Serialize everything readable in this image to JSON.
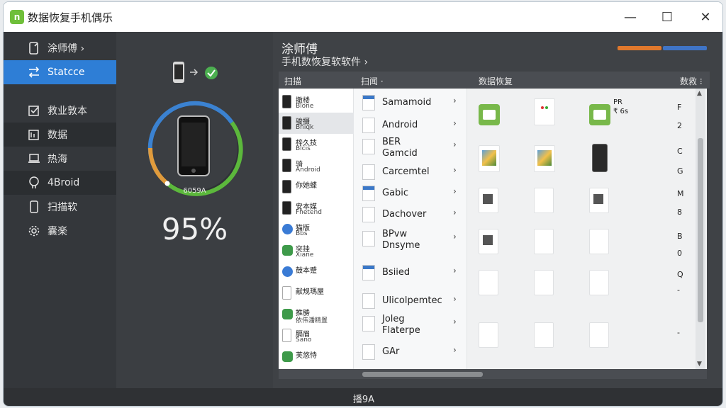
{
  "window": {
    "title": "数据恢复手机偶乐",
    "app_icon_text": "n",
    "minimize_glyph": "—",
    "maximize_glyph": "☐",
    "close_glyph": "✕"
  },
  "sidebar": {
    "items": [
      {
        "label": "涂师傅 ›",
        "icon": "phone-edit-icon"
      },
      {
        "label": "Statcce",
        "icon": "transfer-icon",
        "active": true
      },
      {
        "label": "救业敦本",
        "icon": "checkbox-icon"
      },
      {
        "label": "数据",
        "icon": "photo-icon"
      },
      {
        "label": "热海",
        "icon": "laptop-icon"
      },
      {
        "label": "4Broid",
        "icon": "android-icon"
      },
      {
        "label": "扫描软",
        "icon": "phone-icon"
      },
      {
        "label": "囊楽",
        "icon": "gear-icon"
      }
    ]
  },
  "progress": {
    "percent_text": "95%",
    "ring_label": "6059A",
    "percent": 95,
    "ring_colors": {
      "blue": "#3b82d1",
      "green": "#5cb83c",
      "orange": "#e09b3c"
    }
  },
  "main": {
    "title": "涂师傅",
    "subtitle": "手机数恢复软软件 ›",
    "headers": [
      "扫描",
      "扫闻 ·",
      "数据恢复",
      "数救 ⁝"
    ]
  },
  "apps": [
    {
      "name": "撤楼",
      "sub": "Blone",
      "icon": "phone-icon"
    },
    {
      "name": "骏摄",
      "sub": "Bhiqk",
      "icon": "phone-icon",
      "selected": true
    },
    {
      "name": "梓久技",
      "sub": "Blcis",
      "icon": "phone-icon"
    },
    {
      "name": "骑",
      "sub": "Android",
      "icon": "phone-icon"
    },
    {
      "name": "你她蝶",
      "sub": "",
      "icon": "phone-icon"
    },
    {
      "name": "安本媒",
      "sub": "Fhetend",
      "icon": "phone-icon"
    },
    {
      "name": "猫版",
      "sub": "Bbs",
      "icon": "app-blue-icon"
    },
    {
      "name": "突挂",
      "sub": "Xiane",
      "icon": "app-green-icon"
    },
    {
      "name": "鼓本蹙",
      "sub": "",
      "icon": "app-blue-icon"
    },
    {
      "name": "献规瑪屋",
      "sub": "",
      "icon": "doc-icon"
    },
    {
      "name": "推勝",
      "sub": "依伟潘精置",
      "icon": "app-green-icon"
    },
    {
      "name": "膈眉",
      "sub": "Sano",
      "icon": "doc-icon"
    },
    {
      "name": "芙悠恃",
      "sub": "",
      "icon": "app-green-icon"
    }
  ],
  "files": [
    {
      "line1": "Samamoid",
      "line2": "",
      "blue": true
    },
    {
      "line1": "Android",
      "line2": "",
      "blue": false
    },
    {
      "line1": "BER",
      "line2": "Gamcid",
      "blue": false
    },
    {
      "line1": "Carcemtel",
      "line2": "",
      "blue": false
    },
    {
      "line1": "Gabic",
      "line2": "",
      "blue": true
    },
    {
      "line1": "Dachover",
      "line2": "",
      "blue": false
    },
    {
      "line1": "BPvw",
      "line2": "Dnsyme",
      "blue": false
    },
    {
      "line1": "Bsiied",
      "line2": "",
      "blue": true
    },
    {
      "line1": "Ulicolpemtec",
      "line2": "",
      "blue": false
    },
    {
      "line1": "Joleg",
      "line2": "Flaterpe",
      "blue": false
    },
    {
      "line1": "GAr",
      "line2": "",
      "blue": false
    }
  ],
  "grid_labels": {
    "r1c3_line1": "PR",
    "r1c3_line2": "₹ 6s"
  },
  "letters": [
    "F",
    "2",
    "C",
    "G",
    "M",
    "8",
    "B",
    "0",
    "Q",
    "-",
    "-"
  ],
  "footer": {
    "text": "播9A"
  }
}
